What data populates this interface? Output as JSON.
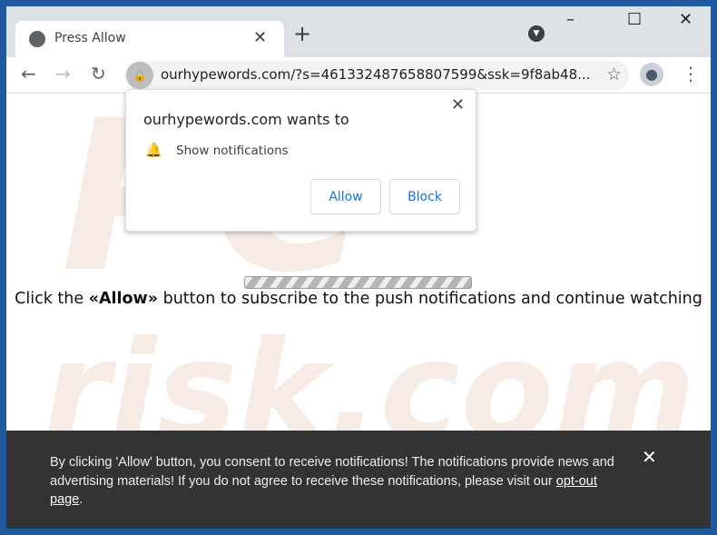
{
  "browser": {
    "tab_title": "Press Allow",
    "url": "ourhypewords.com/?s=461332487658807599&ssk=9f8ab48..."
  },
  "popup": {
    "heading": "ourhypewords.com wants to",
    "permission": "Show notifications",
    "allow": "Allow",
    "block": "Block"
  },
  "page": {
    "msg_pre": "Click the ",
    "msg_bold": "«Allow»",
    "msg_post": " button to subscribe to the push notifications and continue watching",
    "progress_label": ""
  },
  "watermark": {
    "top": "PC",
    "bottom": "risk.com"
  },
  "footer": {
    "text": "By clicking 'Allow' button, you consent to receive notifications! The notifications provide news and advertising materials! If you do not agree to receive these notifications, please visit our ",
    "link": "opt-out page",
    "end": "."
  }
}
